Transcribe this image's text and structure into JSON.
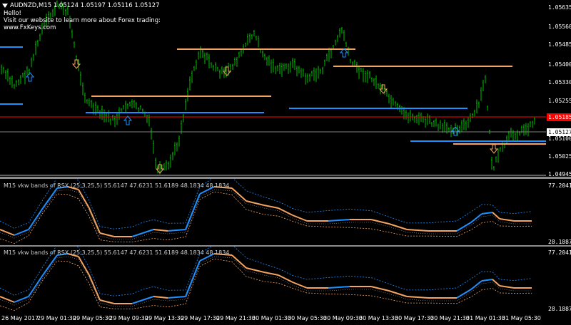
{
  "chart_title": "AUDNZD,M15  1.05124 1.05197 1.05116 1.05127",
  "info_lines": [
    "Hello!",
    "Visit our website to learn more about Forex trading:",
    "www.FxKeys.com"
  ],
  "price_axis": [
    "1.05635",
    "1.05560",
    "1.05485",
    "1.05400",
    "1.05330",
    "1.05255",
    "1.05100",
    "1.05025",
    "1.04945"
  ],
  "current_price": "1.05127",
  "red_price": "1.05185",
  "indicator1_title": "M15 vkw bands of RSX (25,3,25,5) 55.6147 47.6231 51.6189 48.1834 48.1834",
  "indicator2_title": "M15 vkw bands of RSX (25,3,25,5) 55.6147 47.6231 51.6189 48.1834 48.1834",
  "indicator_axis_top": "77.2041",
  "indicator_axis_bottom": "28.1887",
  "time_axis": [
    "26 May 2017",
    "29 May 01:30",
    "29 May 05:30",
    "29 May 09:30",
    "29 May 13:30",
    "29 May 17:30",
    "29 May 21:30",
    "30 May 01:30",
    "30 May 05:30",
    "30 May 09:30",
    "30 May 13:30",
    "30 May 17:30",
    "30 May 21:30",
    "31 May 01:30",
    "31 May 05:30"
  ],
  "colors": {
    "bull_bar": "#00c000",
    "blue_level": "#1e90ff",
    "orange_level": "#f4a460",
    "red_line": "#ff0000",
    "grey_line": "#808080"
  },
  "icons": {
    "up_arrow": "arrow-up-icon",
    "down_arrow": "arrow-down-icon"
  }
}
